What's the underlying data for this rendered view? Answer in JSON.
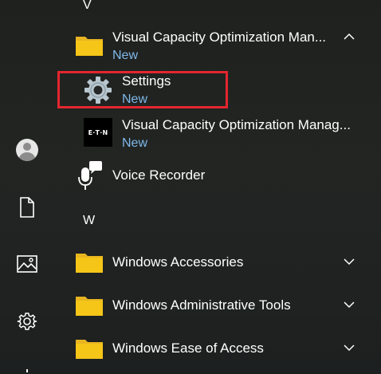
{
  "rail": {
    "items": [
      {
        "name": "user-avatar"
      },
      {
        "name": "documents-icon"
      },
      {
        "name": "pictures-icon"
      },
      {
        "name": "settings-icon"
      }
    ]
  },
  "sections": [
    {
      "letter": "V",
      "apps": [
        {
          "title": "Visual Capacity Optimization Man...",
          "subtitle": "New",
          "icon": "folder-icon",
          "expanded": true
        },
        {
          "title": "Settings",
          "subtitle": "New",
          "icon": "gear-icon",
          "highlighted": true
        },
        {
          "title": "Visual Capacity Optimization Manag...",
          "subtitle": "New",
          "icon": "eaton-logo-icon"
        },
        {
          "title": "Voice Recorder",
          "icon": "microphone-icon"
        }
      ]
    },
    {
      "letter": "W",
      "apps": [
        {
          "title": "Windows Accessories",
          "icon": "folder-icon"
        },
        {
          "title": "Windows Administrative Tools",
          "icon": "folder-icon"
        },
        {
          "title": "Windows Ease of Access",
          "icon": "folder-icon"
        }
      ]
    }
  ],
  "logo": {
    "eaton_text": "E·T·N"
  },
  "colors": {
    "accent_text": "#7fb8ea",
    "highlight": "#e3262f",
    "folder": "#f5c518"
  }
}
